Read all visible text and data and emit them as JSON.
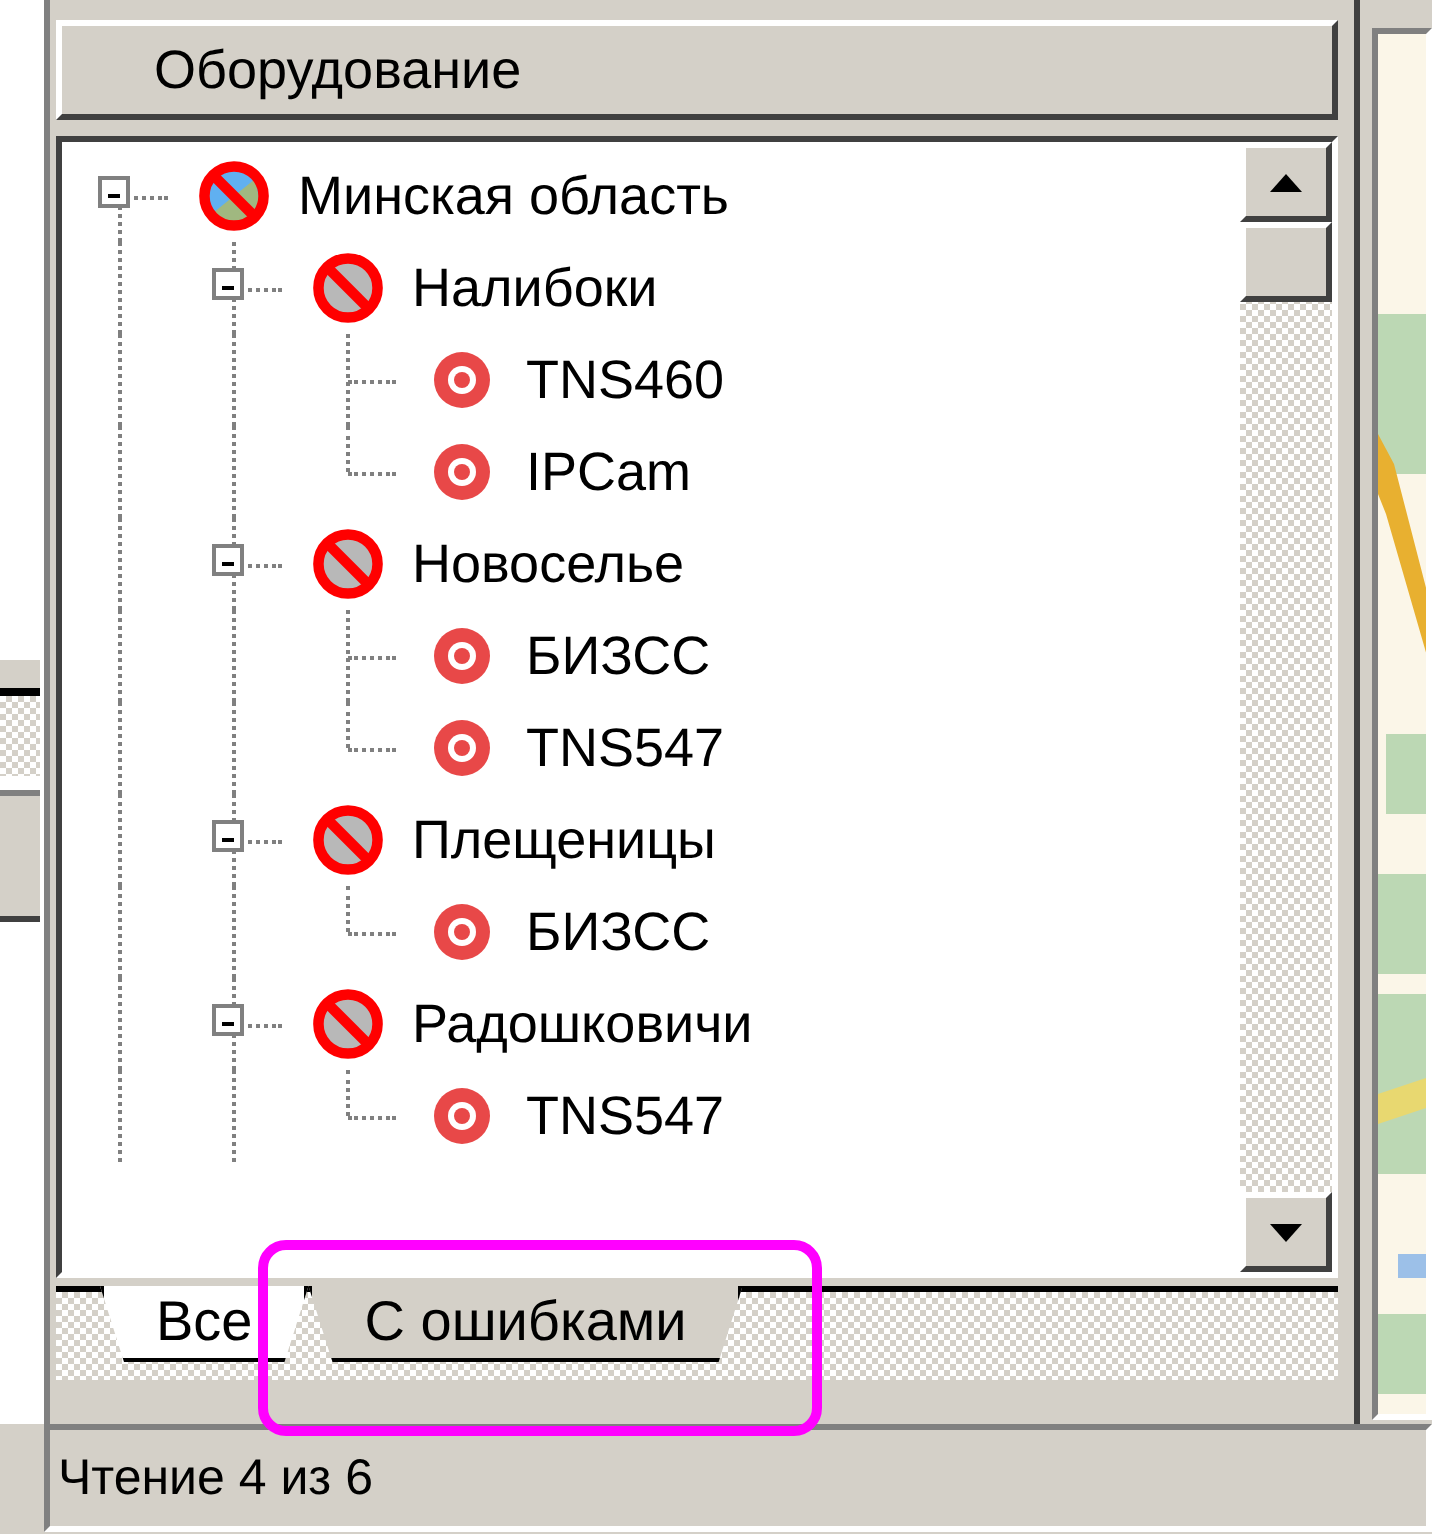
{
  "panel": {
    "title": "Оборудование"
  },
  "tree": [
    {
      "label": "Минская область",
      "kind": "region",
      "expanded": true,
      "children": [
        {
          "label": "Налибоки",
          "kind": "site",
          "expanded": true,
          "children": [
            {
              "label": "TNS460",
              "kind": "device"
            },
            {
              "label": "IPCam",
              "kind": "device"
            }
          ]
        },
        {
          "label": "Новоселье",
          "kind": "site",
          "expanded": true,
          "children": [
            {
              "label": "БИЗСС",
              "kind": "device"
            },
            {
              "label": "TNS547",
              "kind": "device"
            }
          ]
        },
        {
          "label": "Плещеницы",
          "kind": "site",
          "expanded": true,
          "children": [
            {
              "label": "БИЗСС",
              "kind": "device"
            }
          ]
        },
        {
          "label": "Радошковичи",
          "kind": "site",
          "expanded": true,
          "children": [
            {
              "label": "TNS547",
              "kind": "device"
            }
          ]
        }
      ]
    }
  ],
  "tabs": [
    {
      "label": "Все",
      "selected": false
    },
    {
      "label": "С ошибками",
      "selected": true
    }
  ],
  "status_bar": "Чтение 4 из 6"
}
